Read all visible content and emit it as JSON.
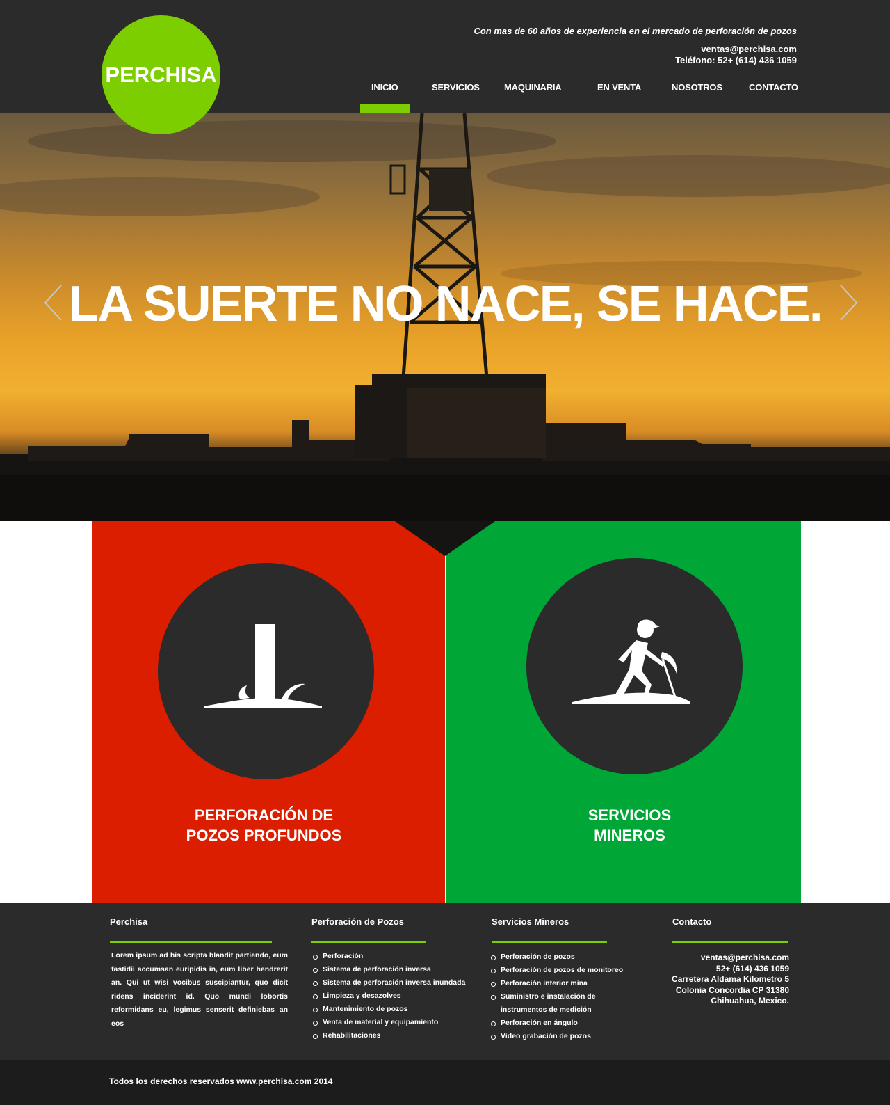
{
  "brand": {
    "logo_text": "PERCHISA",
    "accent": "#7dce00"
  },
  "header": {
    "tagline": "Con mas de  60 años de experiencia  en el mercado de perforación de pozos",
    "email": "ventas@perchisa.com",
    "phone": "Teléfono: 52+ (614) 436 1059"
  },
  "nav": {
    "active": "INICIO",
    "items": [
      "INICIO",
      "SERVICIOS",
      "MAQUINARIA",
      "EN VENTA",
      "NOSOTROS",
      "CONTACTO"
    ]
  },
  "hero": {
    "title": "LA SUERTE NO NACE, SE HACE."
  },
  "panels": [
    {
      "title_line1": "PERFORACIÓN DE",
      "title_line2": "POZOS PROFUNDOS",
      "color": "#dc1e00",
      "icon": "well-drilling-icon"
    },
    {
      "title_line1": "SERVICIOS",
      "title_line2": "MINEROS",
      "color": "#00a636",
      "icon": "miner-icon"
    }
  ],
  "footer": {
    "col1": {
      "title": "Perchisa",
      "text": "Lorem ipsum ad his scripta blandit partiendo, eum fastidii accumsan euripidis in, eum liber hendrerit an. Qui ut wisi vocibus suscipiantur, quo dicit ridens inciderint id. Quo mundi lobortis reformidans eu, legimus senserit definiebas an eos"
    },
    "col2": {
      "title": "Perforación de Pozos",
      "items": [
        "Perforación",
        "Sistema de perforación inversa",
        "Sistema de perforación inversa inundada",
        "Limpieza y desazolves",
        "Mantenimiento de pozos",
        "Venta de material y equipamiento",
        "Rehabilitaciones"
      ]
    },
    "col3": {
      "title": "Servicios Mineros",
      "items": [
        "Perforación de pozos",
        "Perforación de pozos de monitoreo",
        "Perforación interior mina",
        "Suministro e instalación de",
        "instrumentos de medición",
        "Perforación en ángulo",
        "Video grabación de pozos"
      ]
    },
    "col4": {
      "title": "Contacto",
      "lines": [
        "ventas@perchisa.com",
        "52+ (614) 436 1059",
        "Carretera Aldama Kilometro 5",
        "Colonia Concordia CP 31380",
        "Chihuahua, Mexico."
      ]
    },
    "copyright": "Todos los derechos reservados www.perchisa.com 2014"
  }
}
